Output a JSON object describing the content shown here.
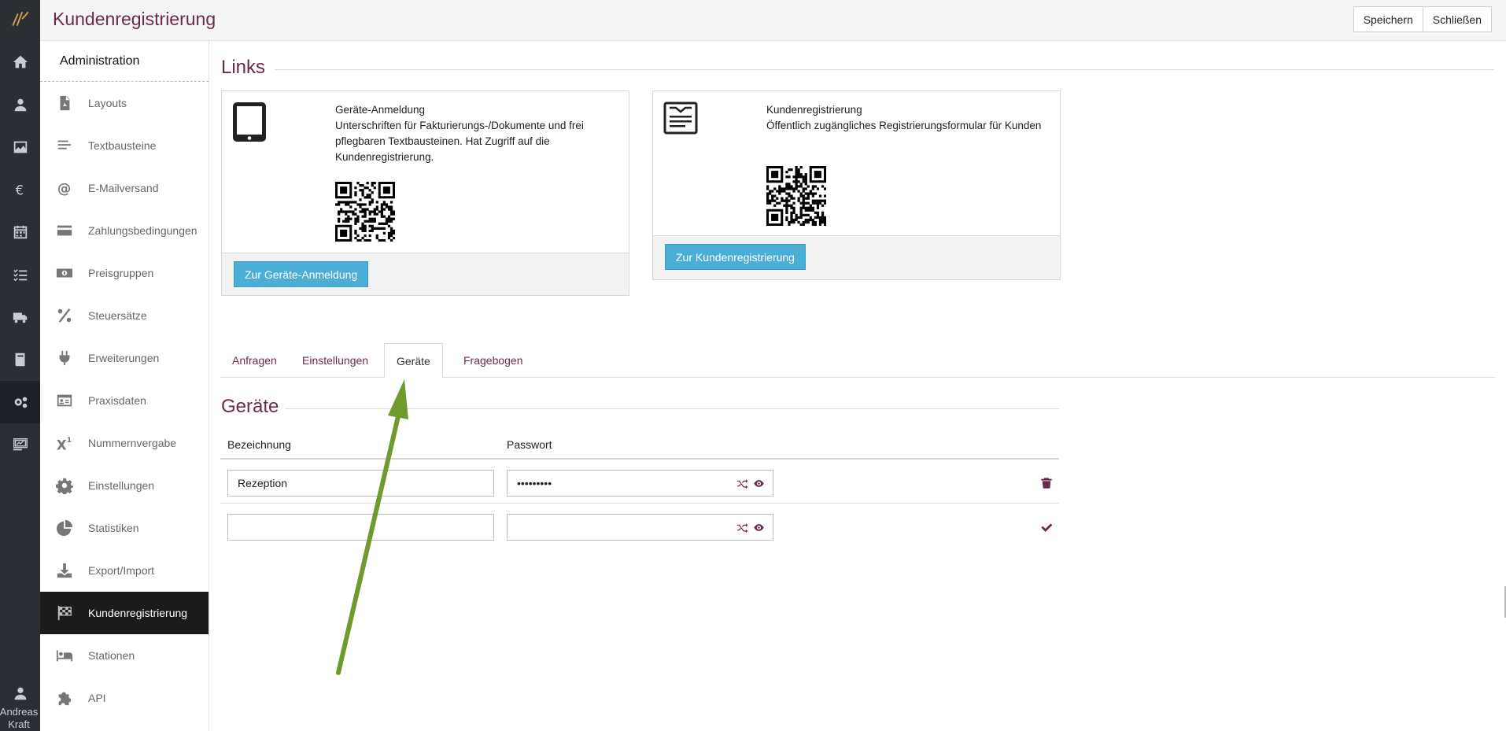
{
  "header": {
    "title": "Kundenregistrierung",
    "save_label": "Speichern",
    "close_label": "Schließen"
  },
  "rail": {
    "icons": [
      "home-icon",
      "person-icon",
      "image-icon",
      "euro-icon",
      "calendar-icon",
      "checklist-icon",
      "truck-icon",
      "book-icon",
      "gears-icon",
      "chart-icon"
    ],
    "active_index": 8,
    "user_name": "Andreas Kraft"
  },
  "sidebar": {
    "heading": "Administration",
    "items": [
      {
        "label": "Layouts",
        "icon": "pdf-file-icon"
      },
      {
        "label": "Textbausteine",
        "icon": "align-left-icon"
      },
      {
        "label": "E-Mailversand",
        "icon": "at-icon"
      },
      {
        "label": "Zahlungsbedingungen",
        "icon": "credit-card-icon"
      },
      {
        "label": "Preisgruppen",
        "icon": "money-bill-icon"
      },
      {
        "label": "Steuersätze",
        "icon": "percent-icon"
      },
      {
        "label": "Erweiterungen",
        "icon": "plug-icon"
      },
      {
        "label": "Praxisdaten",
        "icon": "id-card-icon"
      },
      {
        "label": "Nummernvergabe",
        "icon": "superscript-icon"
      },
      {
        "label": "Einstellungen",
        "icon": "gear-icon"
      },
      {
        "label": "Statistiken",
        "icon": "pie-chart-icon"
      },
      {
        "label": "Export/Import",
        "icon": "download-icon"
      },
      {
        "label": "Kundenregistrierung",
        "icon": "flag-checkered-icon",
        "active": true
      },
      {
        "label": "Stationen",
        "icon": "bed-icon"
      },
      {
        "label": "API",
        "icon": "puzzle-icon"
      }
    ]
  },
  "links": {
    "title": "Links",
    "cards": [
      {
        "icon": "tablet-icon",
        "title": "Geräte-Anmeldung",
        "description": "Unterschriften für Fakturierungs-/Dokumente und frei pflegbaren Textbausteinen. Hat Zugriff auf die Kundenregistrierung.",
        "button": "Zur Geräte-Anmeldung"
      },
      {
        "icon": "form-icon",
        "title": "Kundenregistrierung",
        "description": "Öffentlich zugängliches Registrierungsformular für Kunden",
        "button": "Zur Kundenregistrierung"
      }
    ]
  },
  "tabs": [
    {
      "label": "Anfragen"
    },
    {
      "label": "Einstellungen"
    },
    {
      "label": "Geräte",
      "active": true
    },
    {
      "label": "Fragebogen"
    }
  ],
  "devices": {
    "title": "Geräte",
    "columns": [
      "Bezeichnung",
      "Passwort"
    ],
    "rows": [
      {
        "name": "Rezeption",
        "password": "•••••••••",
        "action_icon": "trash-icon"
      },
      {
        "name": "",
        "password": "",
        "action_icon": "check-icon"
      }
    ]
  },
  "colors": {
    "brand": "#6b2a4d",
    "button_blue": "#4aaed6",
    "rail": "#2b2f33",
    "annotation_arrow": "#6f9a2e"
  }
}
